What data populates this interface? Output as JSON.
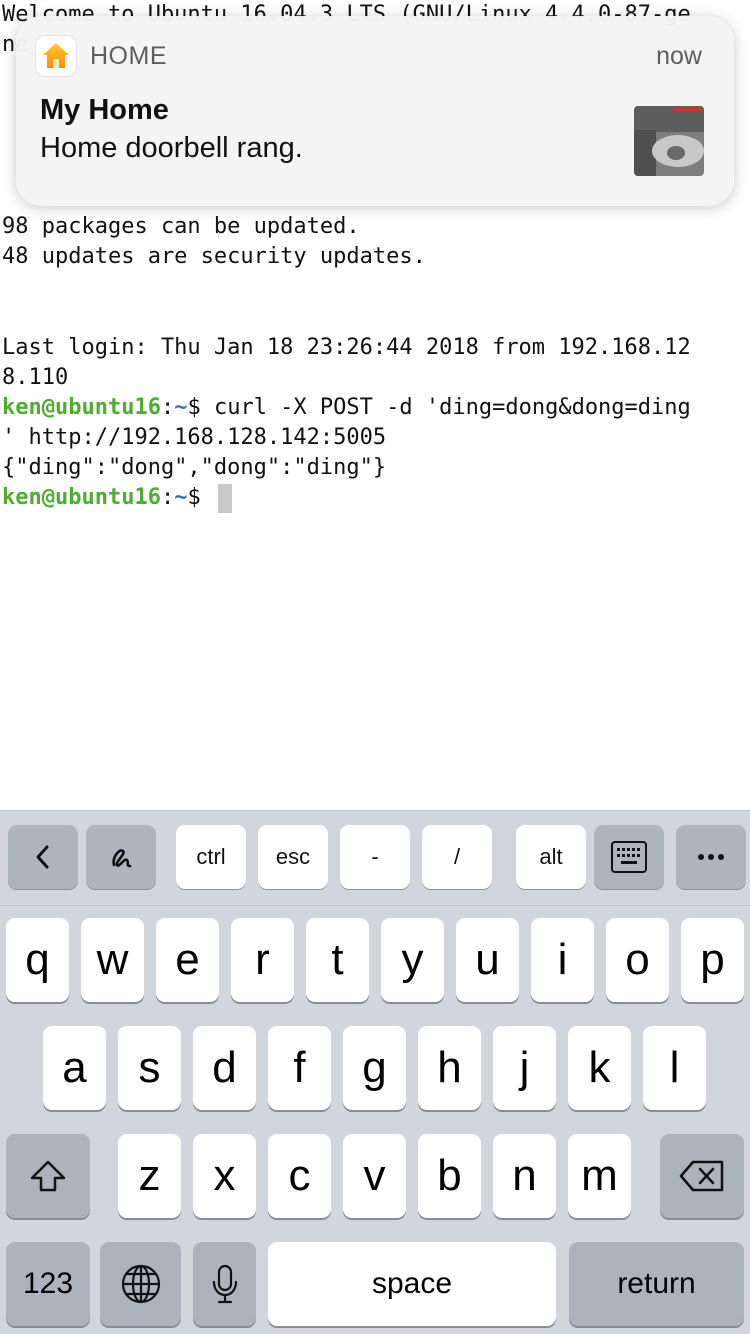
{
  "terminal": {
    "welcome": "Welcome to Ubuntu 16.04.3 LTS (GNU/Linux 4.4.0-87-ge",
    "welcome_cont": "ne",
    "line_packages": "98 packages can be updated.",
    "line_security": "48 updates are security updates.",
    "last_login_1": "Last login: Thu Jan 18 23:26:44 2018 from 192.168.12",
    "last_login_2": "8.110",
    "prompt_user": "ken@ubuntu16",
    "prompt_colon": ":",
    "prompt_path": "~",
    "prompt_dollar": "$ ",
    "command_1": "curl -X POST -d 'ding=dong&dong=ding",
    "command_2": "' http://192.168.128.142:5005",
    "response": "{\"ding\":\"dong\",\"dong\":\"ding\"}"
  },
  "notification": {
    "app_name": "HOME",
    "time": "now",
    "title": "My Home",
    "body": "Home doorbell rang.",
    "app_icon": "home-app-icon",
    "thumbnail": "doorbell-camera-thumbnail"
  },
  "accessory_bar": {
    "keys": [
      "<",
      "scribble",
      "ctrl",
      "esc",
      "-",
      "/",
      "alt",
      "keyboard",
      "..."
    ]
  },
  "keyboard": {
    "row1": [
      "q",
      "w",
      "e",
      "r",
      "t",
      "y",
      "u",
      "i",
      "o",
      "p"
    ],
    "row2": [
      "a",
      "s",
      "d",
      "f",
      "g",
      "h",
      "j",
      "k",
      "l"
    ],
    "row3": [
      "z",
      "x",
      "c",
      "v",
      "b",
      "n",
      "m"
    ],
    "numbers_label": "123",
    "space_label": "space",
    "return_label": "return"
  },
  "colors": {
    "prompt_user": "#4fae2f",
    "prompt_path": "#3a6fc4",
    "keyboard_bg": "#d1d5dc"
  }
}
